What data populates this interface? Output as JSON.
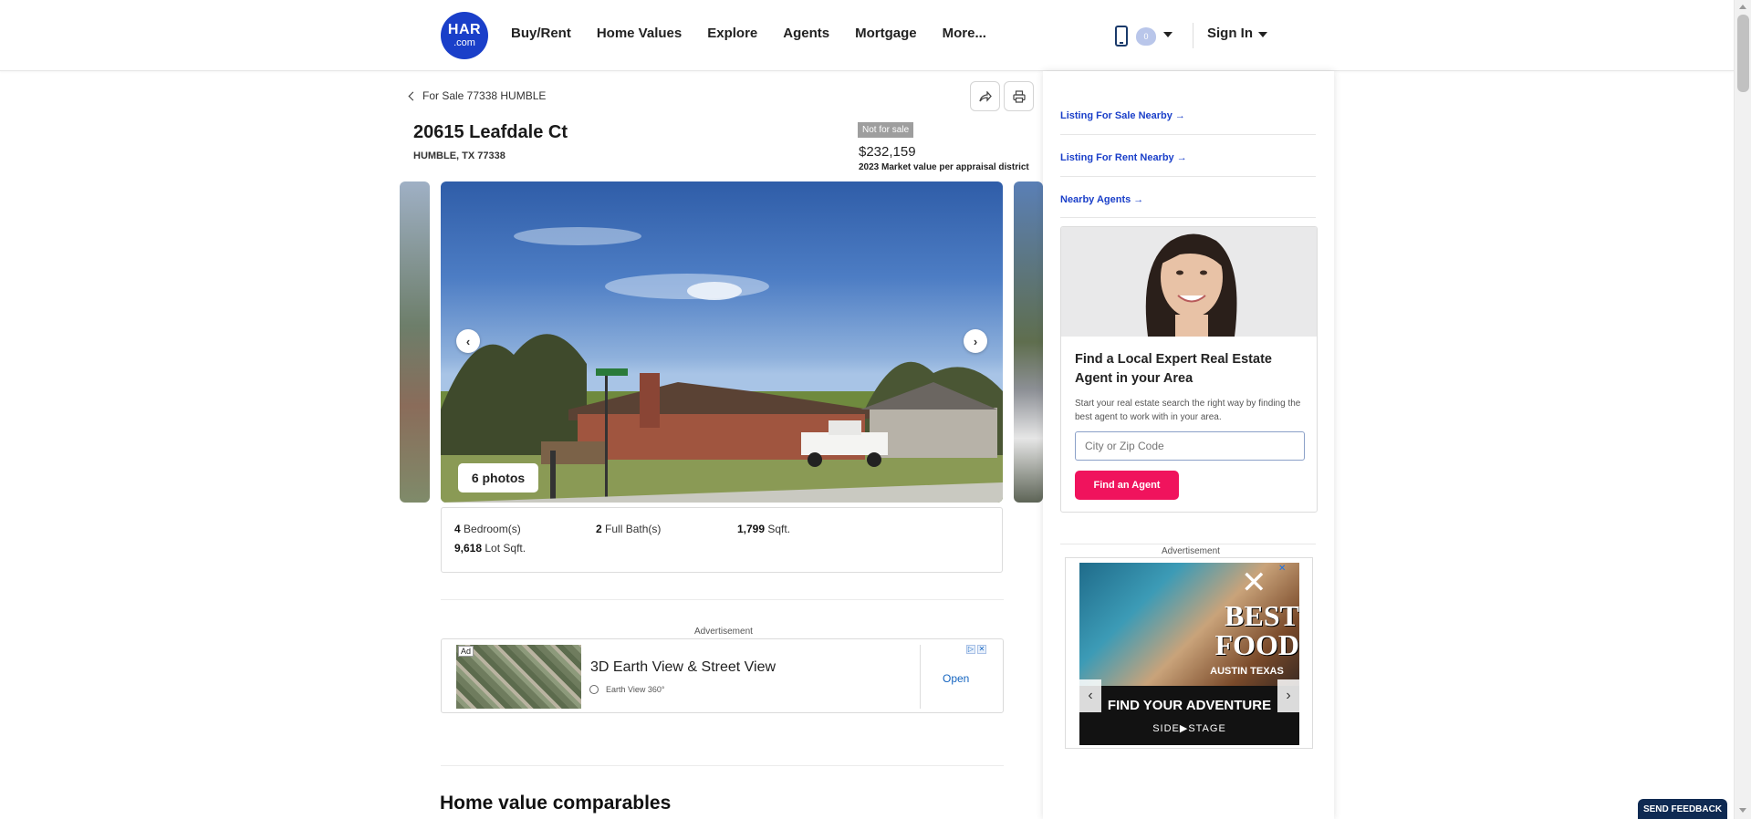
{
  "header": {
    "logo_top": "HAR",
    "logo_bottom": ".com",
    "nav": [
      "Buy/Rent",
      "Home Values",
      "Explore",
      "Agents",
      "Mortgage",
      "More..."
    ],
    "favorites_count": "0",
    "sign_in": "Sign In"
  },
  "breadcrumb": "For Sale 77338 HUMBLE",
  "property": {
    "address": "20615 Leafdale Ct",
    "city_line": "HUMBLE, TX 77338",
    "status": "Not for sale",
    "value": "$232,159",
    "value_note": "2023 Market value per appraisal district",
    "photos_label": "6 photos"
  },
  "facts": {
    "bedrooms_value": "4",
    "bedrooms_label": "Bedroom(s)",
    "baths_value": "2",
    "baths_label": "Full Bath(s)",
    "sqft_value": "1,799",
    "sqft_label": "Sqft.",
    "lot_value": "9,618",
    "lot_label": "Lot Sqft."
  },
  "ad_main": {
    "label": "Advertisement",
    "tag": "Ad",
    "title": "3D Earth View & Street View",
    "subtitle": "Earth View 360°",
    "cta": "Open"
  },
  "section_title": "Home value comparables",
  "sidebar": {
    "links": [
      "Listing For Sale Nearby →",
      "Listing For Rent Nearby →",
      "Nearby Agents →"
    ],
    "agent_heading": "Find a Local Expert Real Estate Agent in your Area",
    "agent_text": "Start your real estate search the right way by finding the best agent to work with in your area.",
    "agent_placeholder": "City or Zip Code",
    "agent_button": "Find an Agent",
    "ad_label": "Advertisement",
    "ad_best": "BEST FOOD",
    "ad_city": "AUSTIN TEXAS",
    "ad_tagline": "FIND YOUR ADVENTURE",
    "ad_brand": "SIDE▶STAGE"
  },
  "feedback": "SEND FEEDBACK",
  "colors": {
    "brand_blue": "#1a3fc9",
    "cta_pink": "#f0135d",
    "feedback_navy": "#0f2a52"
  }
}
